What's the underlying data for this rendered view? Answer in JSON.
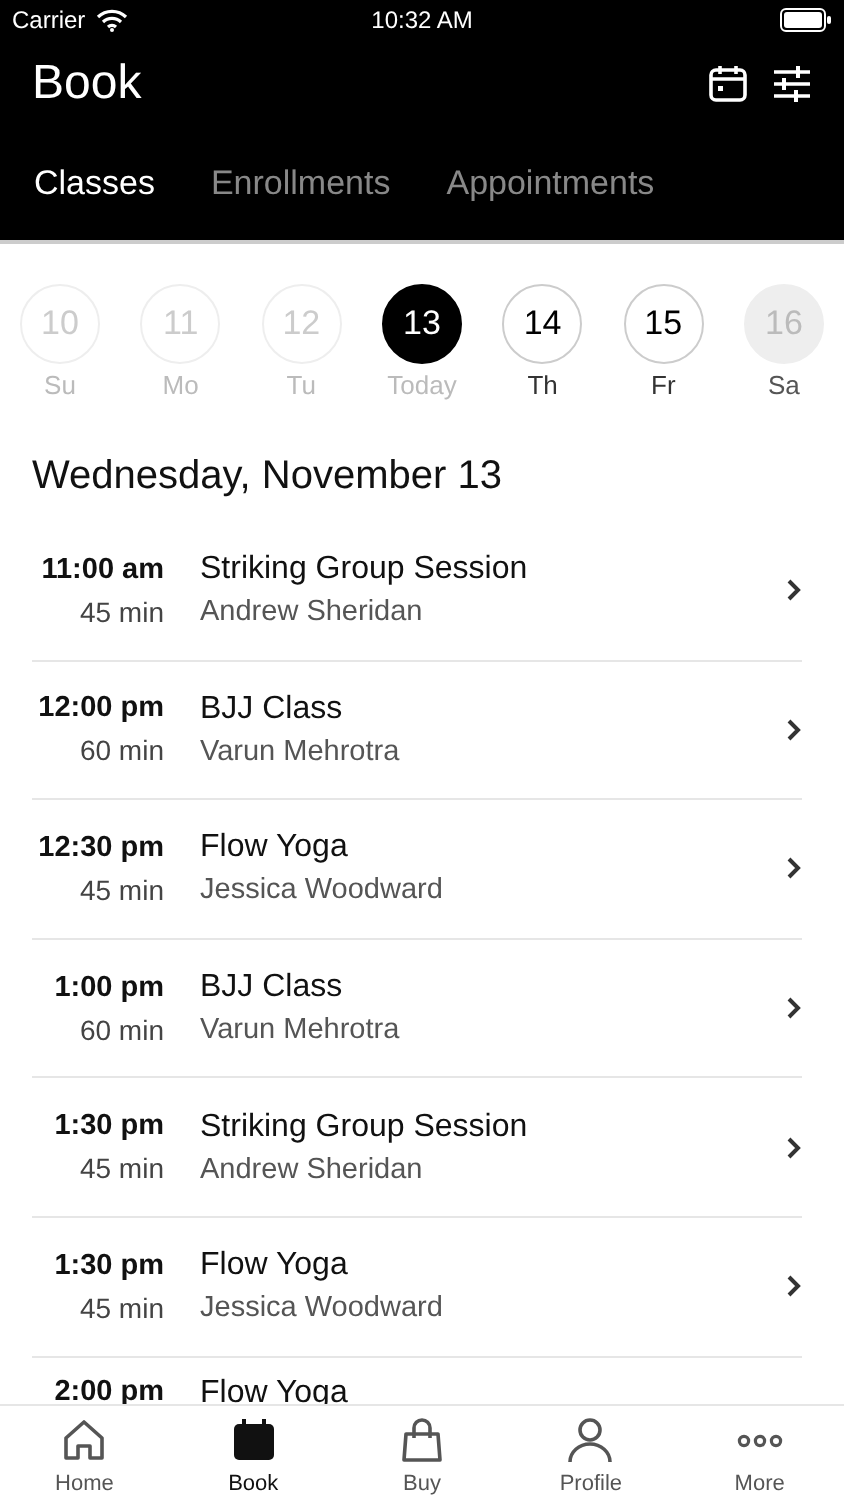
{
  "status_bar": {
    "carrier": "Carrier",
    "time": "10:32 AM"
  },
  "header": {
    "title": "Book"
  },
  "tabs": [
    {
      "label": "Classes",
      "selected": true
    },
    {
      "label": "Enrollments",
      "selected": false
    },
    {
      "label": "Appointments",
      "selected": false
    }
  ],
  "days": [
    {
      "number": "10",
      "label": "Su",
      "kind": "past",
      "selected": false
    },
    {
      "number": "11",
      "label": "Mo",
      "kind": "past",
      "selected": false
    },
    {
      "number": "12",
      "label": "Tu",
      "kind": "past",
      "selected": false
    },
    {
      "number": "13",
      "label": "Today",
      "kind": "past",
      "selected": true
    },
    {
      "number": "14",
      "label": "Th",
      "kind": "future",
      "selected": false
    },
    {
      "number": "15",
      "label": "Fr",
      "kind": "future",
      "selected": false
    },
    {
      "number": "16",
      "label": "Sa",
      "kind": "unavailable",
      "selected": false
    }
  ],
  "date_heading": "Wednesday, November 13",
  "classes": [
    {
      "time": "11:00 am",
      "duration": "45 min",
      "name": "Striking Group Session",
      "instructor": "Andrew Sheridan"
    },
    {
      "time": "12:00 pm",
      "duration": "60 min",
      "name": "BJJ Class",
      "instructor": "Varun Mehrotra"
    },
    {
      "time": "12:30 pm",
      "duration": "45 min",
      "name": "Flow Yoga",
      "instructor": "Jessica Woodward"
    },
    {
      "time": "1:00 pm",
      "duration": "60 min",
      "name": "BJJ Class",
      "instructor": "Varun Mehrotra"
    },
    {
      "time": "1:30 pm",
      "duration": "45 min",
      "name": "Striking Group Session",
      "instructor": "Andrew Sheridan"
    },
    {
      "time": "1:30 pm",
      "duration": "45 min",
      "name": "Flow Yoga",
      "instructor": "Jessica Woodward"
    },
    {
      "time": "2:00 pm",
      "name": "Flow Yoga"
    }
  ],
  "tab_bar": [
    {
      "label": "Home",
      "kind": "home",
      "selected": false
    },
    {
      "label": "Book",
      "kind": "book",
      "selected": true
    },
    {
      "label": "Buy",
      "kind": "buy",
      "selected": false
    },
    {
      "label": "Profile",
      "kind": "profile",
      "selected": false
    },
    {
      "label": "More",
      "kind": "more",
      "selected": false
    }
  ]
}
